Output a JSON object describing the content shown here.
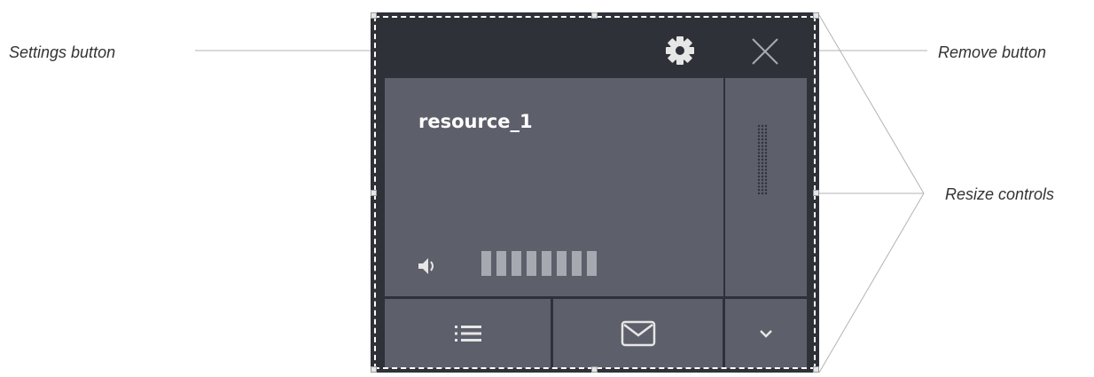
{
  "callouts": {
    "settings": "Settings button",
    "remove": "Remove button",
    "resize": "Resize controls"
  },
  "widget": {
    "resource_name": "resource_1",
    "volume_level": 1.0,
    "volume_bar_count": 8
  },
  "icons": {
    "settings": "gear-icon",
    "remove": "close-icon",
    "volume": "speaker-icon",
    "list": "list-icon",
    "message": "envelope-icon",
    "expand": "chevron-down-icon",
    "grip": "drag-grip-icon"
  },
  "colors": {
    "widget_bg": "#2f3138",
    "panel_bg": "#5d5f6b",
    "icon_light": "#e6e6e6",
    "volume_bar": "#a7a9b1",
    "callout_text": "#333333",
    "leader_line": "#b3b3b3"
  }
}
